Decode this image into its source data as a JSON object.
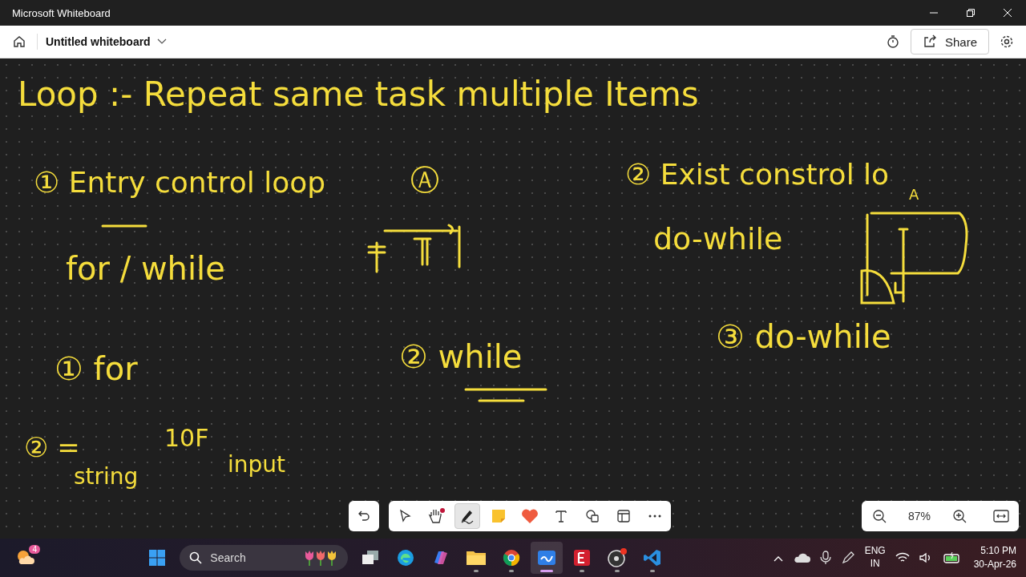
{
  "window": {
    "title": "Microsoft Whiteboard"
  },
  "header": {
    "board_title": "Untitled whiteboard",
    "share": "Share"
  },
  "ink": [
    {
      "text": "Loop :- Repeat same task multiple Items"
    },
    {
      "text": "① Entry control loop"
    },
    {
      "text": "Ⓐ"
    },
    {
      "text": "② Exist constrol lo"
    },
    {
      "text": "for / while"
    },
    {
      "text": "do-while"
    },
    {
      "text": "A"
    },
    {
      "text": "① for"
    },
    {
      "text": "② while"
    },
    {
      "text": "③ do-while"
    },
    {
      "text": "② ="
    },
    {
      "text": "string"
    },
    {
      "text": "10F"
    },
    {
      "text": "input"
    }
  ],
  "toolbar": {
    "tools": [
      {
        "kind": "select",
        "selected": false
      },
      {
        "kind": "hand",
        "selected": false
      },
      {
        "kind": "pen",
        "selected": true
      },
      {
        "kind": "note",
        "selected": false
      },
      {
        "kind": "reaction",
        "selected": false
      },
      {
        "kind": "text",
        "selected": false
      },
      {
        "kind": "shapes",
        "selected": false
      },
      {
        "kind": "template",
        "selected": false
      },
      {
        "kind": "more",
        "selected": false
      }
    ]
  },
  "zoom": {
    "value": "87%"
  },
  "taskbar": {
    "weather_badge": "4",
    "search_placeholder": "Search",
    "apps": [
      {
        "kind": "taskview",
        "running": false,
        "active": false
      },
      {
        "kind": "edge",
        "running": false,
        "active": false
      },
      {
        "kind": "copilot",
        "running": false,
        "active": false
      },
      {
        "kind": "explorer",
        "running": true,
        "active": false
      },
      {
        "kind": "chrome",
        "running": true,
        "active": false
      },
      {
        "kind": "whiteboard",
        "running": true,
        "active": true
      },
      {
        "kind": "reader",
        "running": true,
        "active": false
      },
      {
        "kind": "recorder",
        "running": true,
        "active": false
      },
      {
        "kind": "vscode",
        "running": true,
        "active": false
      }
    ],
    "language": "ENG",
    "region": "IN",
    "time": "5:10 PM",
    "date": "30-Apr-26"
  }
}
